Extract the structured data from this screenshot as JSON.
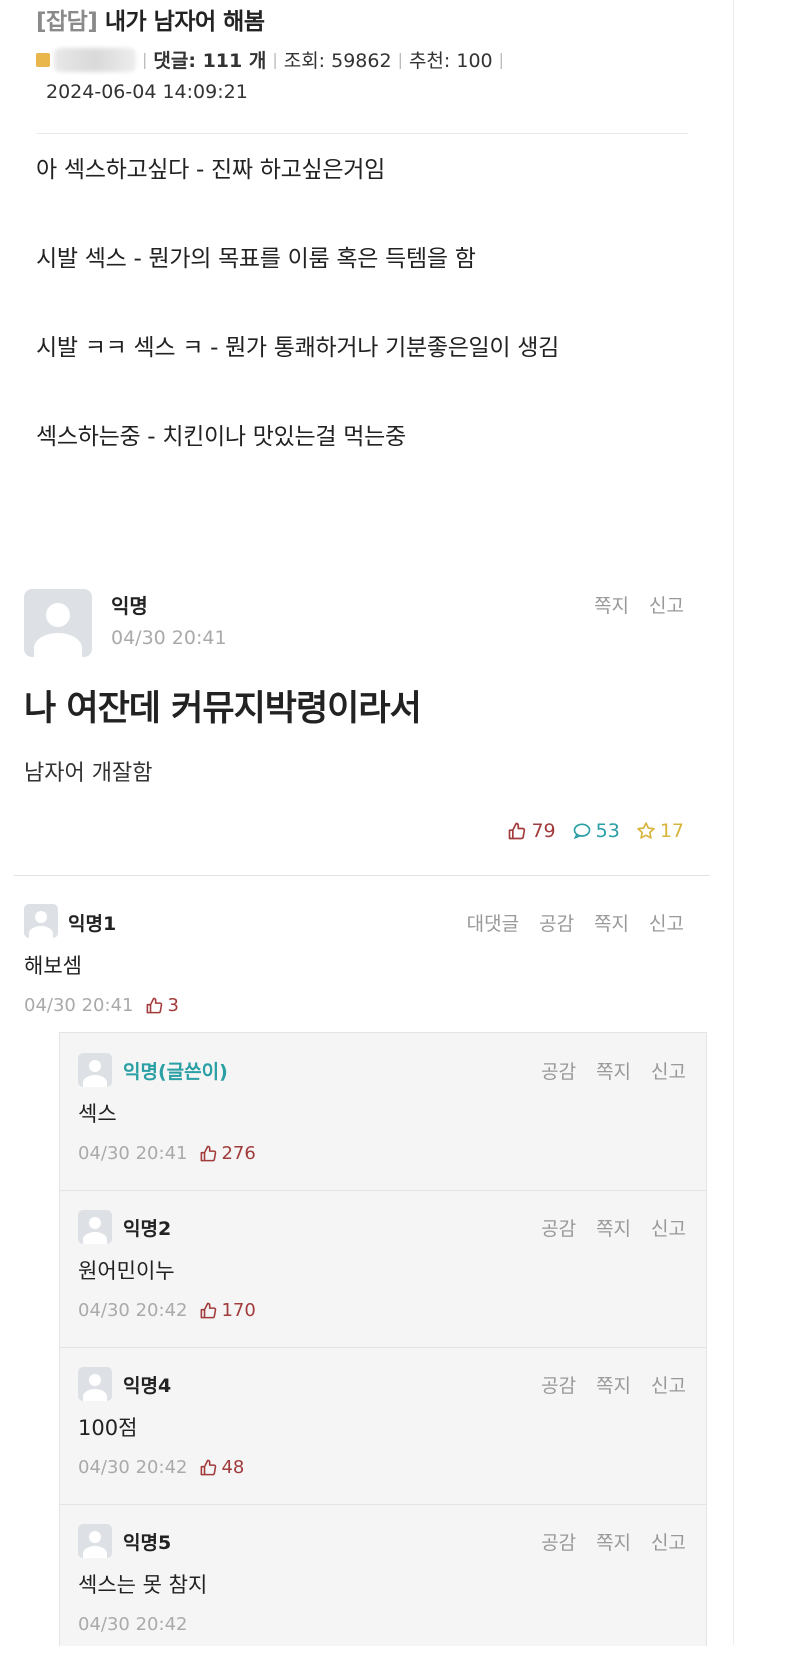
{
  "post": {
    "category": "[잡담]",
    "title": "내가 남자어 해봄",
    "comments_label": "댓글: 111 개",
    "views_label": "조회: 59862",
    "recommend_label": "추천: 100",
    "datetime": "2024-06-04 14:09:21",
    "body_lines": [
      "아 섹스하고싶다 - 진짜 하고싶은거임",
      "시발 섹스 - 뭔가의 목표를 이룸 혹은 득템을 함",
      "시발 ㅋㅋ 섹스 ㅋ - 뭔가 통쾌하거나 기분좋은일이 생김",
      "섹스하는중 - 치킨이나 맛있는걸 먹는중"
    ]
  },
  "main_comment": {
    "author": "익명",
    "time": "04/30 20:41",
    "actions": [
      "쪽지",
      "신고"
    ],
    "title": "나 여잔데 커뮤지박령이라서",
    "text": "남자어 개잘함",
    "likes": "79",
    "comments": "53",
    "scraps": "17"
  },
  "comments": [
    {
      "author": "익명1",
      "text": "해보셈",
      "time": "04/30 20:41",
      "likes": "3",
      "actions": [
        "대댓글",
        "공감",
        "쪽지",
        "신고"
      ]
    }
  ],
  "replies": [
    {
      "author": "익명(글쓴이)",
      "text": "섹스",
      "time": "04/30 20:41",
      "likes": "276",
      "actions": [
        "공감",
        "쪽지",
        "신고"
      ]
    },
    {
      "author": "익명2",
      "text": "원어민이누",
      "time": "04/30 20:42",
      "likes": "170",
      "actions": [
        "공감",
        "쪽지",
        "신고"
      ]
    },
    {
      "author": "익명4",
      "text": "100점",
      "time": "04/30 20:42",
      "likes": "48",
      "actions": [
        "공감",
        "쪽지",
        "신고"
      ]
    },
    {
      "author": "익명5",
      "text": "섹스는 못 참지",
      "time": "04/30 20:42",
      "likes": "",
      "actions": [
        "공감",
        "쪽지",
        "신고"
      ]
    }
  ],
  "colors": {
    "accent_teal": "#2a9fa4",
    "like_red": "#a23b3b",
    "star_yellow": "#d7b43a"
  },
  "icons": [
    "thumbs-up-icon",
    "comment-bubble-icon",
    "star-icon",
    "default-avatar-icon"
  ]
}
